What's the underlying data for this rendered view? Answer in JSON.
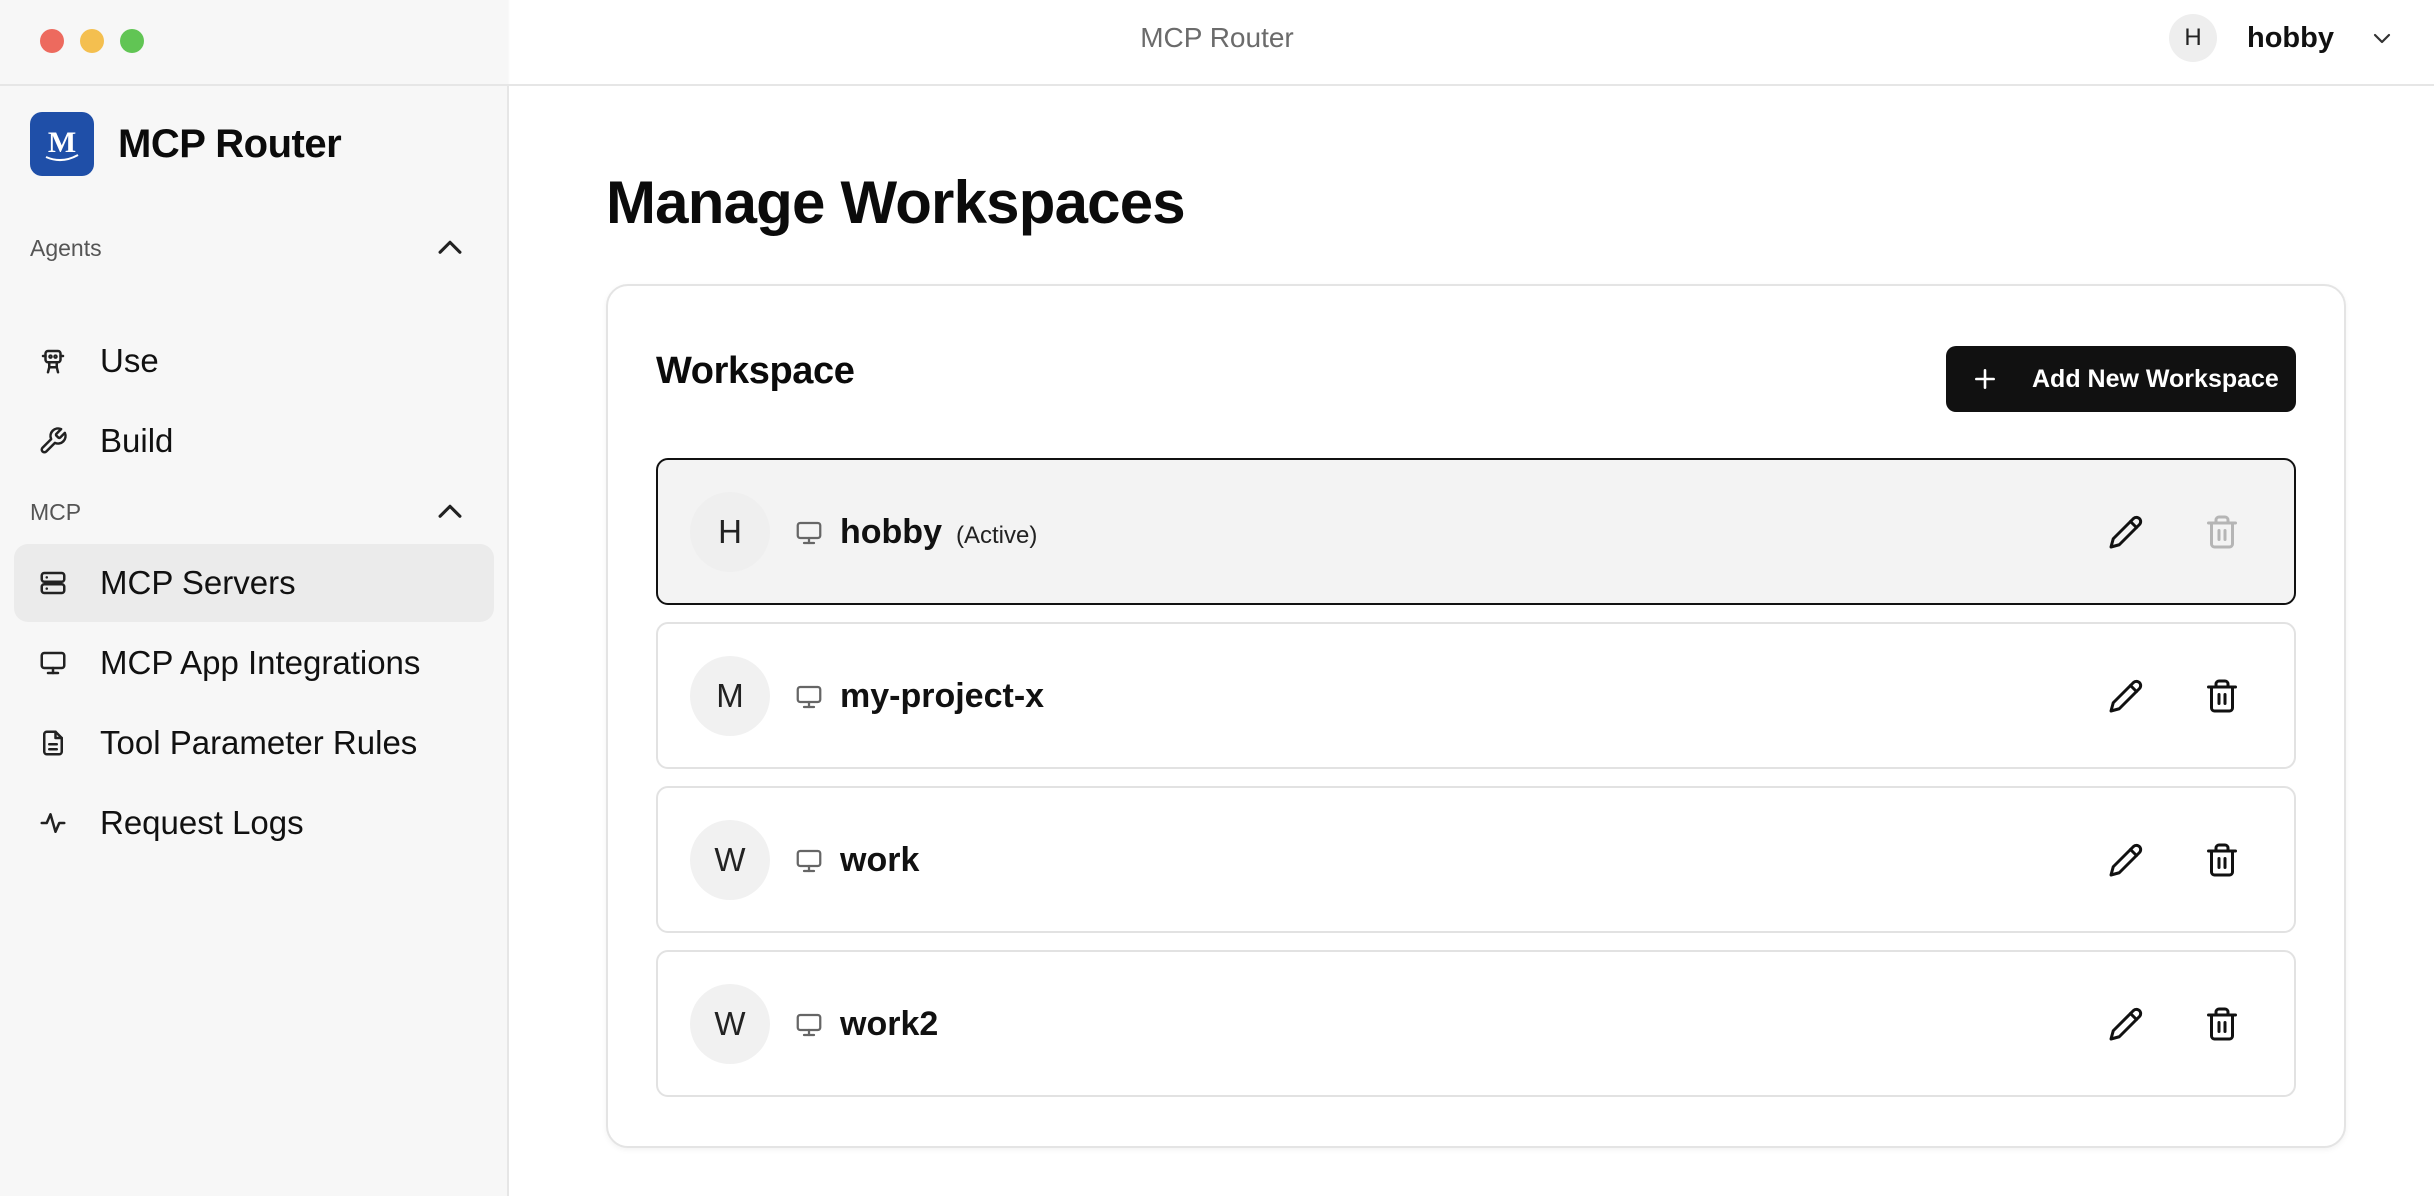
{
  "window": {
    "title": "MCP Router"
  },
  "user": {
    "initial": "H",
    "name": "hobby"
  },
  "brand": {
    "name": "MCP Router",
    "logo_letter": "M"
  },
  "sidebar": {
    "sections": [
      {
        "label": "Agents",
        "items": [
          {
            "label": "Use",
            "icon": "robot-icon"
          },
          {
            "label": "Build",
            "icon": "wrench-icon"
          }
        ]
      },
      {
        "label": "MCP",
        "items": [
          {
            "label": "MCP Servers",
            "icon": "server-icon",
            "active": true
          },
          {
            "label": "MCP App Integrations",
            "icon": "monitor-icon"
          },
          {
            "label": "Tool Parameter Rules",
            "icon": "document-icon"
          },
          {
            "label": "Request Logs",
            "icon": "activity-icon"
          }
        ]
      }
    ]
  },
  "main": {
    "title": "Manage Workspaces",
    "card_title": "Workspace",
    "add_button_label": "Add New Workspace",
    "workspaces": [
      {
        "initial": "H",
        "name": "hobby",
        "badge": "(Active)",
        "active": true,
        "delete_enabled": false
      },
      {
        "initial": "M",
        "name": "my-project-x",
        "badge": "",
        "active": false,
        "delete_enabled": true
      },
      {
        "initial": "W",
        "name": "work",
        "badge": "",
        "active": false,
        "delete_enabled": true
      },
      {
        "initial": "W",
        "name": "work2",
        "badge": "",
        "active": false,
        "delete_enabled": true
      }
    ]
  }
}
